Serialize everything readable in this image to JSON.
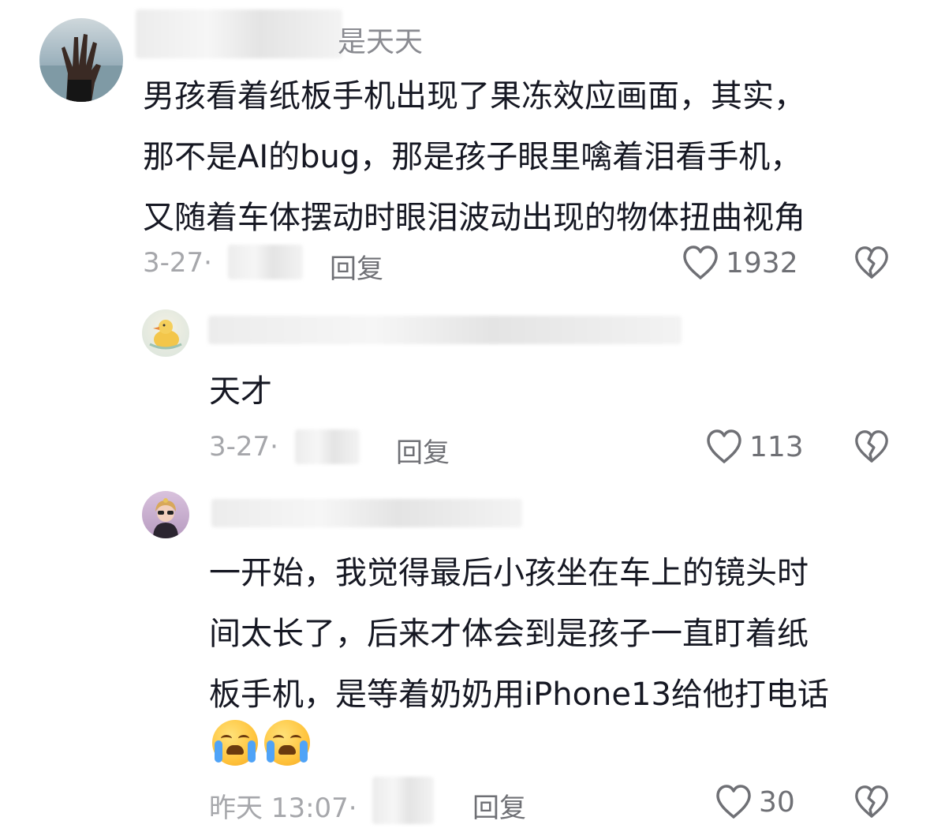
{
  "comments": [
    {
      "username_suffix": "是天天",
      "avatar_icon": "raised-hand-avatar",
      "lines": [
        "男孩看着纸板手机出现了果冻效应画面，其实，",
        "那不是AI的bug，那是孩子眼里噙着泪看手机，",
        "又随着车体摆动时眼泪波动出现的物体扭曲视角"
      ],
      "date": "3-27",
      "separator": "·",
      "reply_label": "回复",
      "like_count": "1932"
    },
    {
      "avatar_icon": "rubber-duck-avatar",
      "lines": [
        "天才"
      ],
      "date": "3-27",
      "separator": "·",
      "reply_label": "回复",
      "like_count": "113"
    },
    {
      "avatar_icon": "girl-sunglasses-avatar",
      "lines": [
        "一开始，我觉得最后小孩坐在车上的镜头时",
        "间太长了，后来才体会到是孩子一直盯着纸",
        "板手机，是等着奶奶用iPhone13给他打电话"
      ],
      "emojis": [
        "loudly-crying-face",
        "loudly-crying-face"
      ],
      "date": "昨天 13:07",
      "separator": "·",
      "reply_label": "回复",
      "like_count": "30"
    }
  ],
  "colors": {
    "text": "#161823",
    "muted": "#a6a7ab",
    "action": "#6f7075",
    "emoji": "#ffc43d"
  }
}
